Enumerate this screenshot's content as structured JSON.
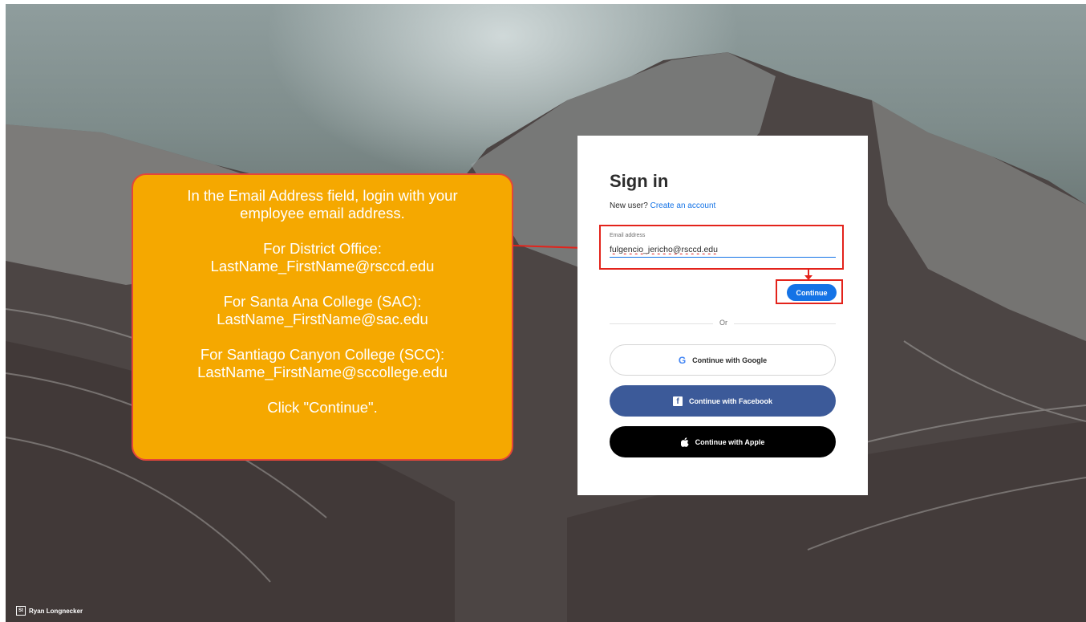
{
  "background": {
    "credit": "Ryan Longnecker",
    "credit_logo": "St"
  },
  "callout": {
    "lines": [
      "In the Email Address field, login with your employee email address.",
      "For District Office: LastName_FirstName@rsccd.edu",
      "For Santa Ana College (SAC): LastName_FirstName@sac.edu",
      "For Santiago Canyon College (SCC): LastName_FirstName@sccollege.edu",
      "Click \"Continue\"."
    ],
    "accent": "#f5a800",
    "border": "#e3463a"
  },
  "signin": {
    "title": "Sign in",
    "new_user_prefix": "New user?",
    "create_account_link": "Create an account",
    "email_label": "Email address",
    "email_value": "fulgencio_jericho@rsccd.edu",
    "continue_label": "Continue",
    "or_label": "Or",
    "google_label": "Continue with Google",
    "facebook_label": "Continue with Facebook",
    "apple_label": "Continue with Apple",
    "google_icon": "G",
    "facebook_icon": "f",
    "accent": "#1473e6",
    "highlight": "#e3231b"
  }
}
